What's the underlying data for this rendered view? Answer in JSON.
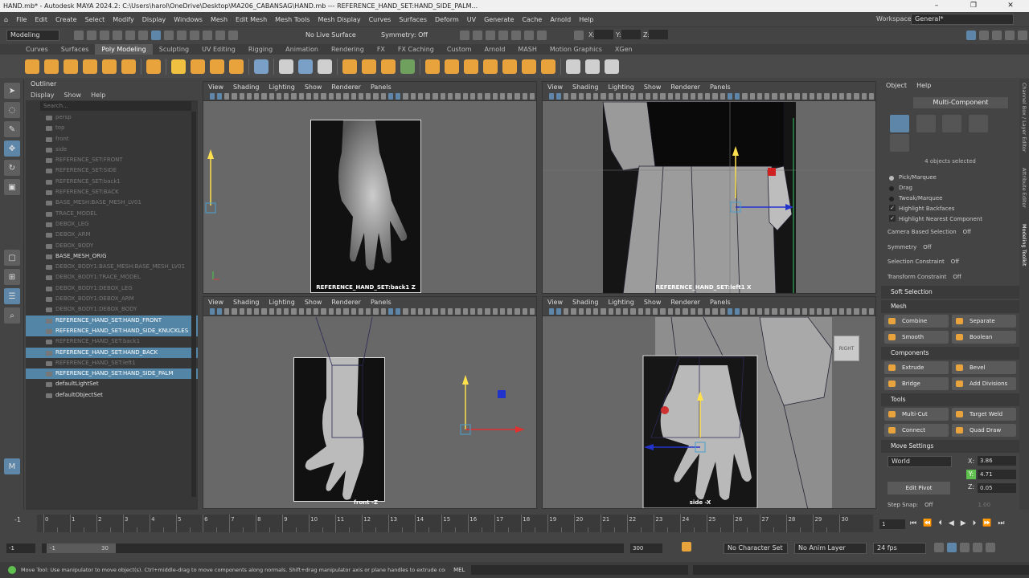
{
  "window": {
    "title": "HAND.mb* - Autodesk MAYA 2024.2: C:\\Users\\harol\\OneDrive\\Desktop\\MA206_CABANSAG\\HAND.mb  ---  REFERENCE_HAND_SET:HAND_SIDE_PALM...",
    "controls": [
      "–",
      "❐",
      "✕"
    ]
  },
  "menubar": {
    "items": [
      "File",
      "Edit",
      "Create",
      "Select",
      "Modify",
      "Display",
      "Windows",
      "Mesh",
      "Edit Mesh",
      "Mesh Tools",
      "Mesh Display",
      "Curves",
      "Surfaces",
      "Deform",
      "UV",
      "Generate",
      "Cache",
      "Arnold",
      "Help"
    ],
    "workspace_label": "Workspace:",
    "workspace_value": "General*"
  },
  "statusline": {
    "menuset": "Modeling",
    "live_surface": "No Live Surface",
    "symmetry": "Symmetry: Off",
    "x_label": "X:",
    "y_label": "Y:",
    "z_label": "Z:"
  },
  "shelf": {
    "tabs": [
      "Curves",
      "Surfaces",
      "Poly Modeling",
      "Sculpting",
      "UV Editing",
      "Rigging",
      "Animation",
      "Rendering",
      "FX",
      "FX Caching",
      "Custom",
      "Arnold",
      "MASH",
      "Motion Graphics",
      "XGen"
    ],
    "active_tab": "Poly Modeling"
  },
  "outliner": {
    "title": "Outliner",
    "menu": [
      "Display",
      "Show",
      "Help"
    ],
    "search_placeholder": "Search...",
    "items": [
      {
        "label": "persp",
        "state": "dim"
      },
      {
        "label": "top",
        "state": "dim"
      },
      {
        "label": "front",
        "state": "dim"
      },
      {
        "label": "side",
        "state": "dim"
      },
      {
        "label": "REFERENCE_SET:FRONT",
        "state": "dim"
      },
      {
        "label": "REFERENCE_SET:SIDE",
        "state": "dim"
      },
      {
        "label": "REFERENCE_SET:back1",
        "state": "dim"
      },
      {
        "label": "REFERENCE_SET:BACK",
        "state": "dim"
      },
      {
        "label": "BASE_MESH:BASE_MESH_LV01",
        "state": "dim"
      },
      {
        "label": "TRACE_MODEL",
        "state": "dim"
      },
      {
        "label": "DEBOX_LEG",
        "state": "dim"
      },
      {
        "label": "DEBOX_ARM",
        "state": "dim"
      },
      {
        "label": "DEBOX_BODY",
        "state": "dim"
      },
      {
        "label": "BASE_MESH_ORIG",
        "state": "active"
      },
      {
        "label": "DEBOX_BODY1:BASE_MESH:BASE_MESH_LV01",
        "state": "dim"
      },
      {
        "label": "DEBOX_BODY1:TRACE_MODEL",
        "state": "dim"
      },
      {
        "label": "DEBOX_BODY1:DEBOX_LEG",
        "state": "dim"
      },
      {
        "label": "DEBOX_BODY1:DEBOX_ARM",
        "state": "dim"
      },
      {
        "label": "DEBOX_BODY1:DEBOX_BODY",
        "state": "dim"
      },
      {
        "label": "REFERENCE_HAND_SET:HAND_FRONT",
        "state": "selected"
      },
      {
        "label": "REFERENCE_HAND_SET:HAND_SIDE_KNUCKLES",
        "state": "selected"
      },
      {
        "label": "REFERENCE_HAND_SET:back1",
        "state": "dim"
      },
      {
        "label": "REFERENCE_HAND_SET:HAND_BACK",
        "state": "selected"
      },
      {
        "label": "REFERENCE_HAND_SET:left1",
        "state": "dim"
      },
      {
        "label": "REFERENCE_HAND_SET:HAND_SIDE_PALM",
        "state": "selected"
      },
      {
        "label": "defaultLightSet",
        "state": "active"
      },
      {
        "label": "defaultObjectSet",
        "state": "active"
      }
    ]
  },
  "viewport_menu": [
    "View",
    "Shading",
    "Lighting",
    "Show",
    "Renderer",
    "Panels"
  ],
  "viewports": {
    "tl_caption": "REFERENCE_HAND_SET:back1 Z",
    "tr_caption": "REFERENCE_HAND_SET:left1 X",
    "bl_caption": "front -Z",
    "br_caption": "side -X",
    "viewcube_label": "RIGHT"
  },
  "toolkit": {
    "menu": [
      "Object",
      "Help"
    ],
    "mode_title": "Multi-Component",
    "selected_count": "4 objects selected",
    "pick_modes": [
      "Pick/Marquee",
      "Drag",
      "Tweak/Marquee"
    ],
    "checks": [
      "Highlight Backfaces",
      "Highlight Nearest Component"
    ],
    "options": [
      {
        "label": "Camera Based Selection",
        "value": "Off"
      },
      {
        "label": "Symmetry",
        "value": "Off"
      },
      {
        "label": "Selection Constraint",
        "value": "Off"
      },
      {
        "label": "Transform Constraint",
        "value": "Off"
      }
    ],
    "soft_selection": "Soft Selection",
    "sections": {
      "mesh": "Mesh",
      "components": "Components",
      "tools": "Tools",
      "move_settings": "Move Settings"
    },
    "mesh_buttons": [
      "Combine",
      "Separate",
      "Smooth",
      "Boolean"
    ],
    "component_buttons": [
      "Extrude",
      "Bevel",
      "Bridge",
      "Add Divisions"
    ],
    "tool_buttons": [
      "Multi-Cut",
      "Target Weld",
      "Connect",
      "Quad Draw"
    ],
    "move": {
      "space": "World",
      "x": "3.86",
      "y": "4.71",
      "z": "0.05",
      "edit_pivot": "Edit Pivot",
      "step_snap_label": "Step Snap:",
      "step_snap_value": "Off",
      "step_value": "1.00"
    },
    "side_tabs": [
      "Channel Box / Layer Editor",
      "Attribute Editor",
      "Modeling Toolkit"
    ]
  },
  "timeline": {
    "ticks": [
      "1",
      "2",
      "3",
      "4",
      "5",
      "6",
      "7",
      "8",
      "9",
      "10",
      "11",
      "12",
      "13",
      "14",
      "15",
      "16",
      "17",
      "18",
      "19",
      "20",
      "21",
      "22",
      "23",
      "24",
      "25",
      "26",
      "27",
      "28",
      "29",
      "30"
    ],
    "start_tick": "0",
    "current_frame": "1",
    "left_marker": "-1"
  },
  "range": {
    "start": "-1",
    "inner_start": "-1",
    "inner_end": "30",
    "end": "300",
    "character_set": "No Character Set",
    "anim_layer": "No Anim Layer",
    "fps": "24 fps"
  },
  "command": {
    "lang": "MEL",
    "help": "Move Tool: Use manipulator to move object(s). Ctrl+middle-drag to move components along normals. Shift+drag manipulator axis or plane handles to extrude components or c"
  },
  "colors": {
    "selection_blue": "#5285a6",
    "accent_orange": "#e8a33c",
    "gizmo_yellow": "#ffe14d",
    "gizmo_red": "#e03030",
    "gizmo_blue": "#2233cc"
  }
}
